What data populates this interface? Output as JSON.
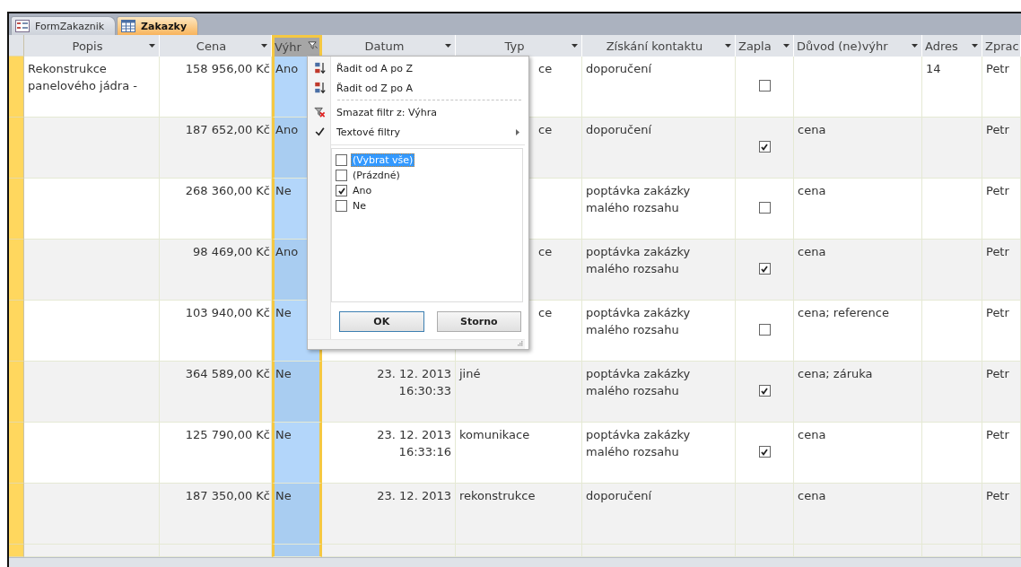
{
  "tabs": [
    {
      "label": "FormZakaznik",
      "kind": "form",
      "selected": false
    },
    {
      "label": "Zakazky",
      "kind": "table",
      "selected": true
    }
  ],
  "columns": [
    {
      "label": "Popis",
      "filtered": false,
      "selected": false
    },
    {
      "label": "Cena",
      "filtered": false,
      "selected": false
    },
    {
      "label": "Výhr",
      "filtered": true,
      "selected": true
    },
    {
      "label": "Datum",
      "filtered": false,
      "selected": false
    },
    {
      "label": "Typ",
      "filtered": false,
      "selected": false
    },
    {
      "label": "Získání kontaktu",
      "filtered": false,
      "selected": false
    },
    {
      "label": "Zapla",
      "filtered": false,
      "selected": false
    },
    {
      "label": "Důvod (ne)výhr",
      "filtered": false,
      "selected": false
    },
    {
      "label": "Adres",
      "filtered": false,
      "selected": false
    },
    {
      "label": "Zprac",
      "filtered": false,
      "selected": false
    }
  ],
  "rows": [
    {
      "popis": "Rekonstrukce panelového jádra -",
      "cena": "158 956,00 Kč",
      "vyhra": "Ano",
      "typ": "ce",
      "typ_covered": true,
      "ziskani": "doporučení",
      "zaplaceno": false,
      "adresa": "14",
      "zpracoval": "Petr"
    },
    {
      "cena": "187 652,00 Kč",
      "vyhra": "Ano",
      "typ": "ce",
      "typ_covered": true,
      "ziskani": "doporučení",
      "zaplaceno": true,
      "duvod": "cena",
      "zpracoval": "Petr"
    },
    {
      "cena": "268 360,00 Kč",
      "vyhra": "Ne",
      "ziskani": "poptávka zakázky malého rozsahu",
      "zaplaceno": false,
      "duvod": "cena",
      "zpracoval": "Petr"
    },
    {
      "cena": "98 469,00 Kč",
      "vyhra": "Ano",
      "typ": "ce",
      "typ_covered": true,
      "ziskani": "poptávka zakázky malého rozsahu",
      "zaplaceno": true,
      "duvod": "cena",
      "zpracoval": "Petr"
    },
    {
      "cena": "103 940,00 Kč",
      "vyhra": "Ne",
      "typ": "ce",
      "typ_covered": true,
      "ziskani": "poptávka zakázky malého rozsahu",
      "zaplaceno": false,
      "duvod": "cena; reference",
      "zpracoval": "Petr"
    },
    {
      "cena": "364 589,00 Kč",
      "vyhra": "Ne",
      "datum": "23. 12. 2013",
      "cas": "16:30:33",
      "typ": "jiné",
      "typ_covered": false,
      "ziskani": "poptávka zakázky malého rozsahu",
      "zaplaceno": true,
      "duvod": "cena; záruka",
      "zpracoval": "Petr"
    },
    {
      "cena": "125 790,00 Kč",
      "vyhra": "Ne",
      "datum": "23. 12. 2013",
      "cas": "16:33:16",
      "typ": "komunikace",
      "typ_covered": false,
      "ziskani": "poptávka zakázky malého rozsahu",
      "zaplaceno": true,
      "duvod": "cena",
      "zpracoval": "Petr"
    },
    {
      "cena": "187 350,00 Kč",
      "vyhra": "Ne",
      "datum": "23. 12. 2013",
      "typ": "rekonstrukce",
      "typ_covered": false,
      "ziskani": "doporučení",
      "duvod": "cena",
      "zpracoval": "Petr"
    }
  ],
  "filter_menu": {
    "items": [
      {
        "label": "Řadit od A po Z",
        "kind": "sort-asc"
      },
      {
        "label": "Řadit od Z po A",
        "kind": "sort-desc"
      },
      {
        "label": "Smazat filtr z: Výhra",
        "kind": "clear-filter"
      },
      {
        "label": "Textové filtry",
        "kind": "submenu",
        "checked": true
      }
    ],
    "values": [
      {
        "label": "(Vybrat vše)",
        "checked": false,
        "selected": true
      },
      {
        "label": "(Prázdné)",
        "checked": false,
        "selected": false
      },
      {
        "label": "Ano",
        "checked": true,
        "selected": false
      },
      {
        "label": "Ne",
        "checked": false,
        "selected": false
      }
    ],
    "buttons": [
      "OK",
      "Storno"
    ]
  }
}
